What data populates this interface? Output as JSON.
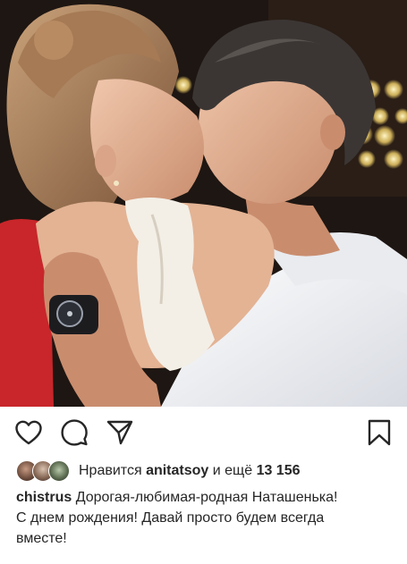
{
  "post": {
    "photo_alt": "",
    "actions": {
      "like_icon": "heart-icon",
      "comment_icon": "comment-icon",
      "share_icon": "paper-plane-icon",
      "save_icon": "bookmark-icon"
    },
    "likes": {
      "prefix": "Нравится",
      "user": "anitatsoy",
      "and_more": "и ещё",
      "count": "13 156"
    },
    "caption": {
      "username": "chistrus",
      "line1": "Дорогая-любимая-родная Наташенька!",
      "line2": "С днем рождения! Давай просто будем всегда",
      "line3": "вместе!"
    }
  },
  "colors": {
    "text": "#262626",
    "background": "#ffffff"
  }
}
